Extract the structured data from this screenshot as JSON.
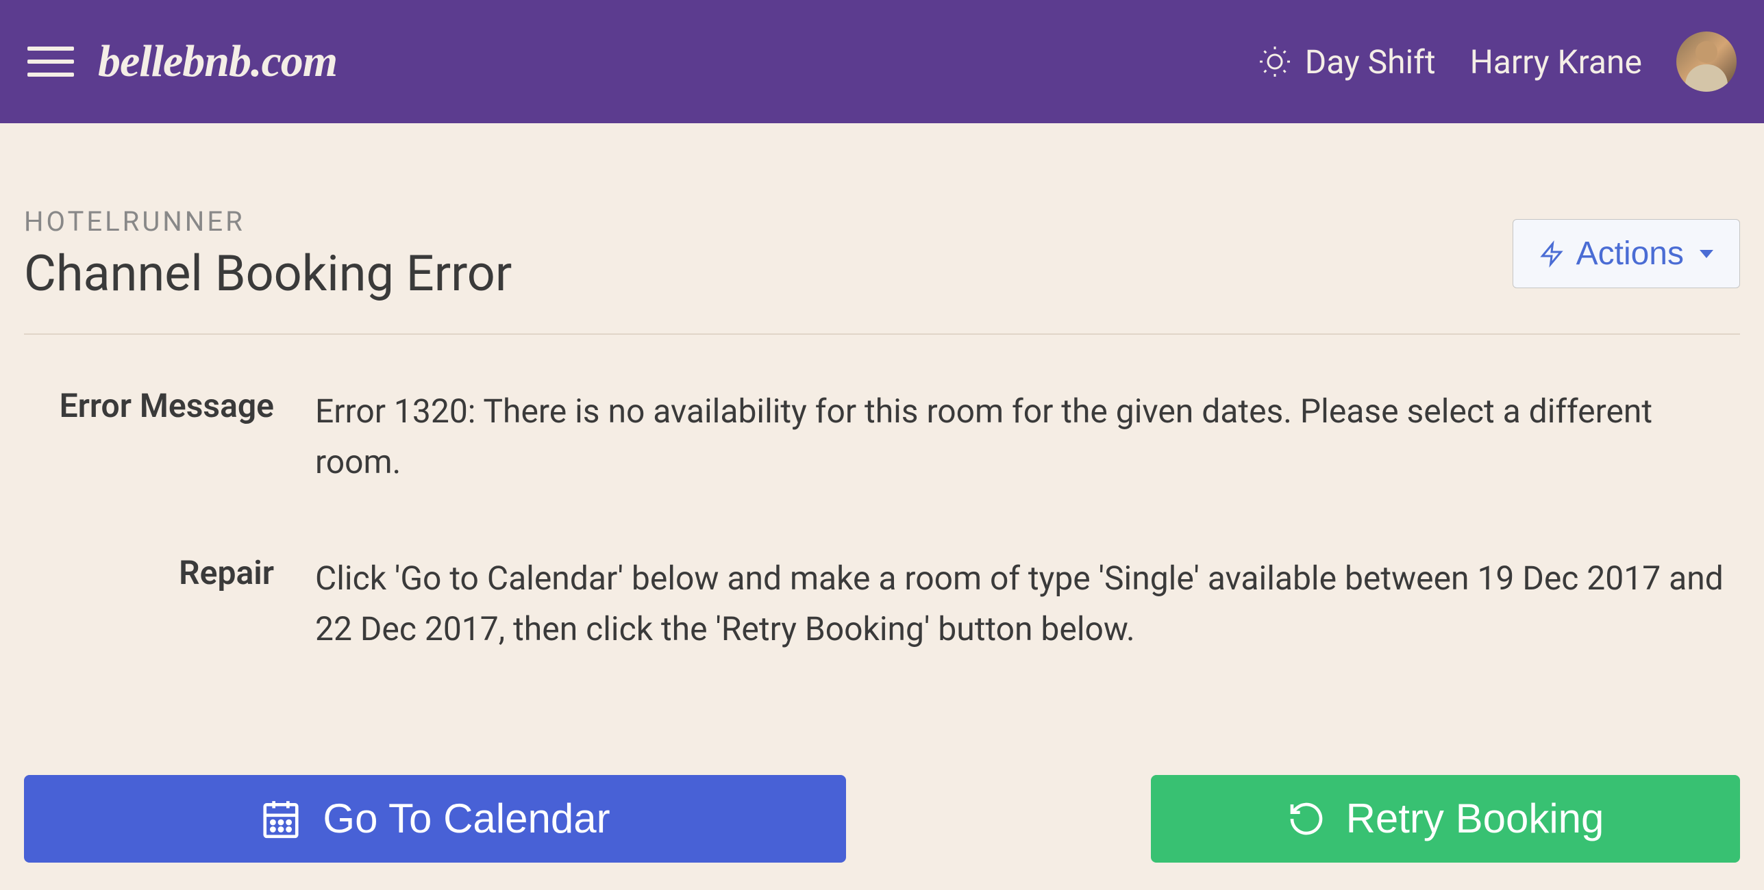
{
  "header": {
    "logo": "bellebnb.com",
    "shift": "Day Shift",
    "user_name": "Harry Krane"
  },
  "page": {
    "eyebrow": "HOTELRUNNER",
    "title": "Channel Booking Error",
    "actions_label": "Actions"
  },
  "details": {
    "error_label": "Error Message",
    "error_value": "Error 1320: There is no availability for this room for the given dates. Please select a different room.",
    "repair_label": "Repair",
    "repair_value": "Click 'Go to Calendar' below and make a room of type 'Single' available between 19 Dec 2017 and 22 Dec 2017, then click the 'Retry Booking' button below."
  },
  "buttons": {
    "calendar": "Go To Calendar",
    "retry": "Retry Booking"
  }
}
